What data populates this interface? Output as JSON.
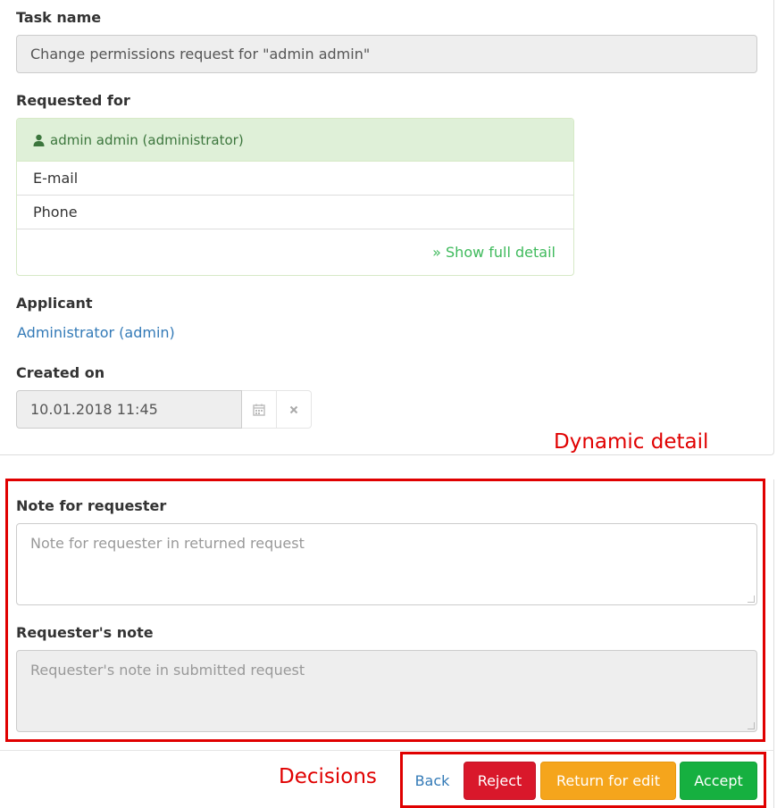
{
  "task": {
    "label": "Task name",
    "value": "Change permissions request for \"admin admin\""
  },
  "requested_for": {
    "label": "Requested for",
    "user": "admin admin (administrator)",
    "email_label": "E-mail",
    "phone_label": "Phone",
    "detail_link": "» Show full detail"
  },
  "applicant": {
    "label": "Applicant",
    "value": "Administrator (admin)"
  },
  "created": {
    "label": "Created on",
    "value": "10.01.2018 11:45"
  },
  "annotations": {
    "dynamic": "Dynamic detail",
    "decisions": "Decisions"
  },
  "notes": {
    "note_label": "Note for requester",
    "note_placeholder": "Note for requester in returned request",
    "req_label": "Requester's note",
    "req_placeholder": "Requester's note in submitted request"
  },
  "buttons": {
    "back": "Back",
    "reject": "Reject",
    "return": "Return for edit",
    "accept": "Accept"
  },
  "colors": {
    "reject": "#d9182b",
    "return": "#f5a51c",
    "accept": "#16b040",
    "annotation": "#e00000",
    "success_text": "#3c763d"
  }
}
